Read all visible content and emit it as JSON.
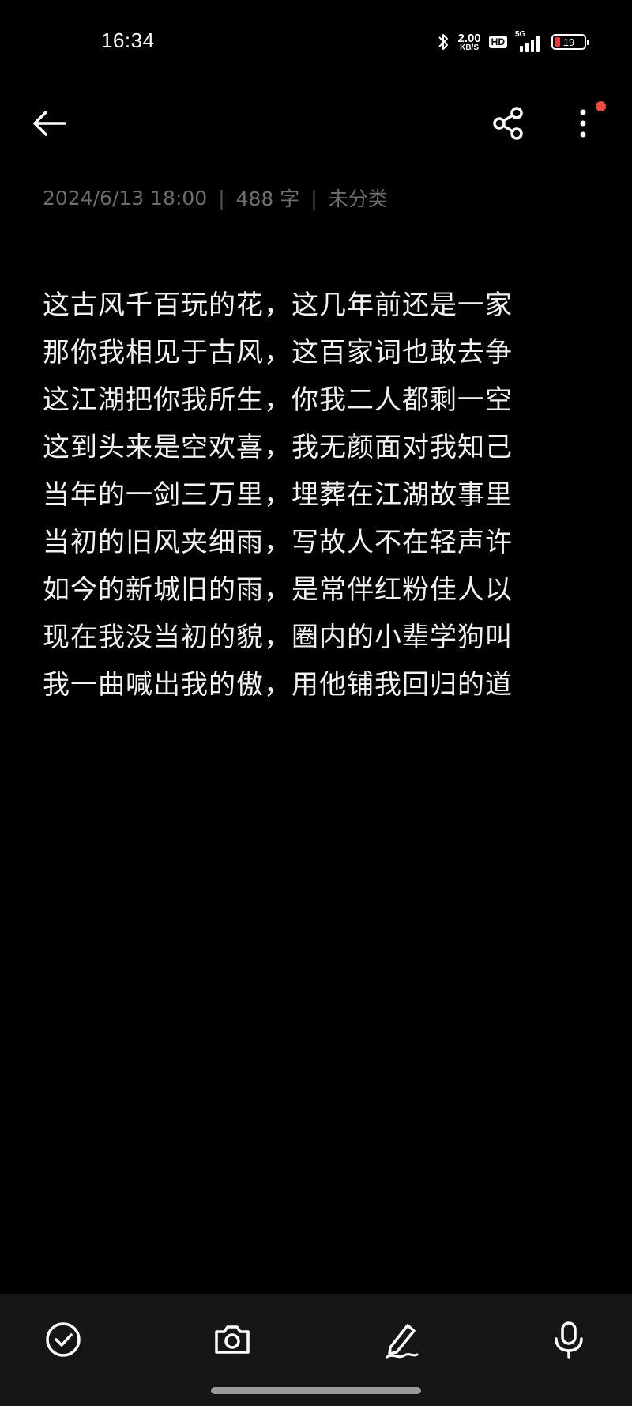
{
  "status_bar": {
    "time": "16:34",
    "net_speed_value": "2.00",
    "net_speed_unit": "KB/S",
    "hd_label": "HD",
    "network_type": "5G",
    "battery_level": "19",
    "battery_color": "#e53935",
    "icons": [
      "bluetooth-icon",
      "signal-icon",
      "battery-icon"
    ]
  },
  "app_bar": {
    "icons": [
      "back-arrow-icon",
      "share-icon",
      "more-vertical-icon"
    ],
    "notification_dot_color": "#ea4b3c"
  },
  "meta": {
    "date": "2024/6/13 18:00",
    "separator": "|",
    "word_count": "488 字",
    "category": "未分类"
  },
  "note": {
    "lines": [
      "这古风千百玩的花，这几年前还是一家",
      "那你我相见于古风，这百家词也敢去争",
      "这江湖把你我所生，你我二人都剩一空",
      "这到头来是空欢喜，我无颜面对我知己",
      "当年的一剑三万里，埋葬在江湖故事里",
      "当初的旧风夹细雨，写故人不在轻声许",
      "如今的新城旧的雨，是常伴红粉佳人以",
      "现在我没当初的貌，圈内的小辈学狗叫",
      "我一曲喊出我的傲，用他铺我回归的道"
    ]
  },
  "toolbar": {
    "icons": [
      "checklist-icon",
      "camera-icon",
      "handwriting-icon",
      "microphone-icon"
    ]
  }
}
